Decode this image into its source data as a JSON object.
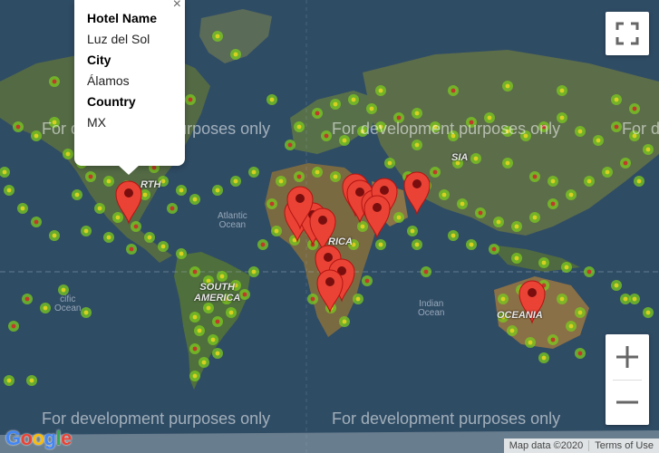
{
  "popup": {
    "hotel_name_label": "Hotel Name",
    "hotel_name": "Luz del Sol",
    "city_label": "City",
    "city": "Álamos",
    "country_label": "Country",
    "country": "MX"
  },
  "watermark": "For development purposes only",
  "map_labels": {
    "atlantic": "Atlantic\nOcean",
    "indian": "Indian\nOcean",
    "pacific": "cific\nOcean",
    "north_america": "RTH",
    "south_america": "SOUTH\nAMERICA",
    "africa": "RICA",
    "asia": "SIA",
    "oceania": "OCEANIA"
  },
  "attribution": {
    "map_data": "Map data ©2020",
    "terms": "Terms of Use"
  },
  "google_logo": "Google",
  "colors": {
    "ocean": "#2f4b63",
    "land": "#4a6a3a",
    "marker": "#ea4335",
    "heat_inner": "#c0392b",
    "heat_outer": "#7bc91f"
  }
}
